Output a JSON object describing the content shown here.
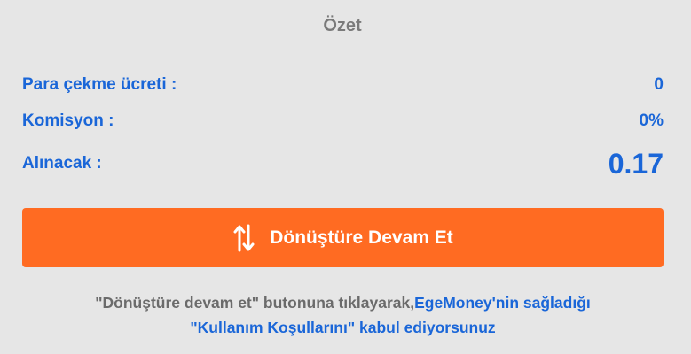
{
  "header": {
    "title": "Özet"
  },
  "summary": {
    "withdraw_fee_label": "Para çekme ücreti :",
    "withdraw_fee_value": "0",
    "commission_label": "Komisyon :",
    "commission_value": "0%",
    "receive_label": "Alınacak :",
    "receive_value": "0.17"
  },
  "cta": {
    "label": "Dönüştüre Devam Et",
    "icon": "swap-vertical-arrows-icon",
    "color": "#ff6b22"
  },
  "terms": {
    "prefix": "\"Dönüştüre devam et\" butonuna tıklayarak,",
    "brand_link": "EgeMoney'nin sağladığı",
    "terms_link": "\"Kullanım Koşullarını\"",
    "suffix": " kabul ediyorsunuz"
  },
  "colors": {
    "accent_blue": "#1a66d8",
    "background": "#e6e6e6",
    "muted_text": "#6b6b6b"
  }
}
